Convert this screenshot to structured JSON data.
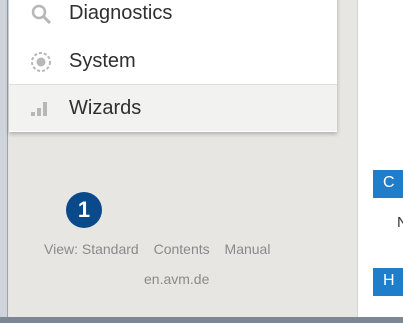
{
  "menu": {
    "items": [
      {
        "label": "Diagnostics",
        "icon": "diagnostics-icon"
      },
      {
        "label": "System",
        "icon": "system-icon"
      },
      {
        "label": "Wizards",
        "icon": "wizards-icon"
      }
    ]
  },
  "badge": {
    "value": "1"
  },
  "footer": {
    "links": [
      "View: Standard",
      "Contents",
      "Manual"
    ],
    "domain": "en.avm.de"
  },
  "right_panel": {
    "tab1": "C",
    "text": "N",
    "tab2": "H"
  },
  "colors": {
    "accent": "#1f7ecb",
    "badge": "#0a4a8a",
    "muted_text": "#8a8a8a"
  }
}
